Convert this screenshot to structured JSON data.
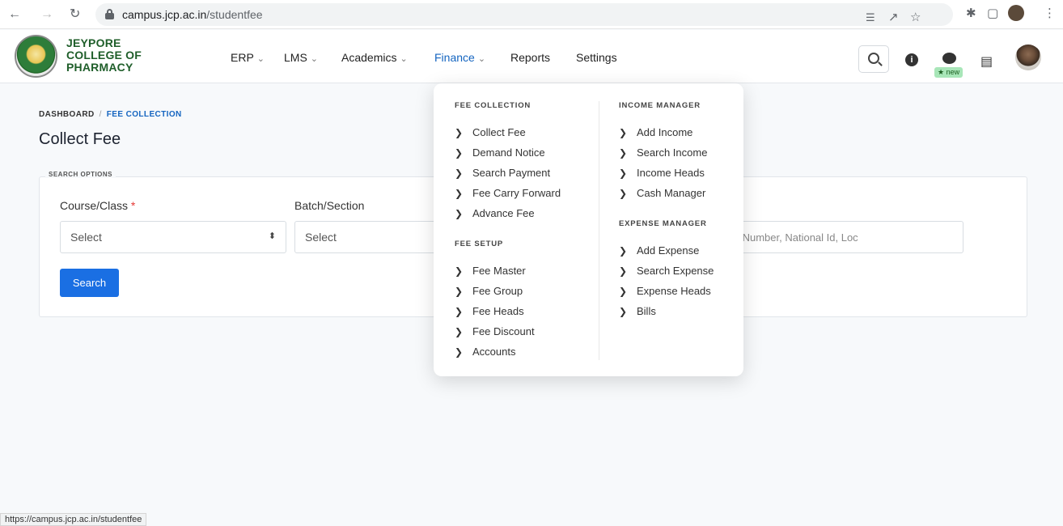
{
  "browser": {
    "url_host": "campus.jcp.ac.in",
    "url_path": "/studentfee",
    "status_url": "https://campus.jcp.ac.in/studentfee"
  },
  "header": {
    "logo_line1": "JEYPORE",
    "logo_line2": "COLLEGE OF",
    "logo_line3": "PHARMACY",
    "menu": [
      "ERP",
      "LMS",
      "Academics",
      "Finance",
      "Reports",
      "Settings"
    ],
    "new_badge": "★ new"
  },
  "breadcrumb": {
    "root": "DASHBOARD",
    "sep": "/",
    "current": "FEE COLLECTION"
  },
  "page_title": "Collect Fee",
  "search_options": {
    "legend": "SEARCH OPTIONS",
    "course_label": "Course/Class",
    "required_mark": "*",
    "course_value": "Select",
    "batch_label": "Batch/Section",
    "batch_value": "Select",
    "keyword_placeholder": "Roll Number, Enroll Number, National Id, Loc",
    "search_button": "Search"
  },
  "finance_dropdown": {
    "fee_collection": {
      "title": "FEE COLLECTION",
      "items": [
        "Collect Fee",
        "Demand Notice",
        "Search Payment",
        "Fee Carry Forward",
        "Advance Fee"
      ]
    },
    "fee_setup": {
      "title": "FEE SETUP",
      "items": [
        "Fee Master",
        "Fee Group",
        "Fee Heads",
        "Fee Discount",
        "Accounts"
      ]
    },
    "income_manager": {
      "title": "INCOME MANAGER",
      "items": [
        "Add Income",
        "Search Income",
        "Income Heads",
        "Cash Manager"
      ]
    },
    "expense_manager": {
      "title": "EXPENSE MANAGER",
      "items": [
        "Add Expense",
        "Search Expense",
        "Expense Heads",
        "Bills"
      ]
    }
  },
  "colors": {
    "accent": "#1565c0",
    "button": "#1a6fe3",
    "brand": "#1f5e2a"
  }
}
